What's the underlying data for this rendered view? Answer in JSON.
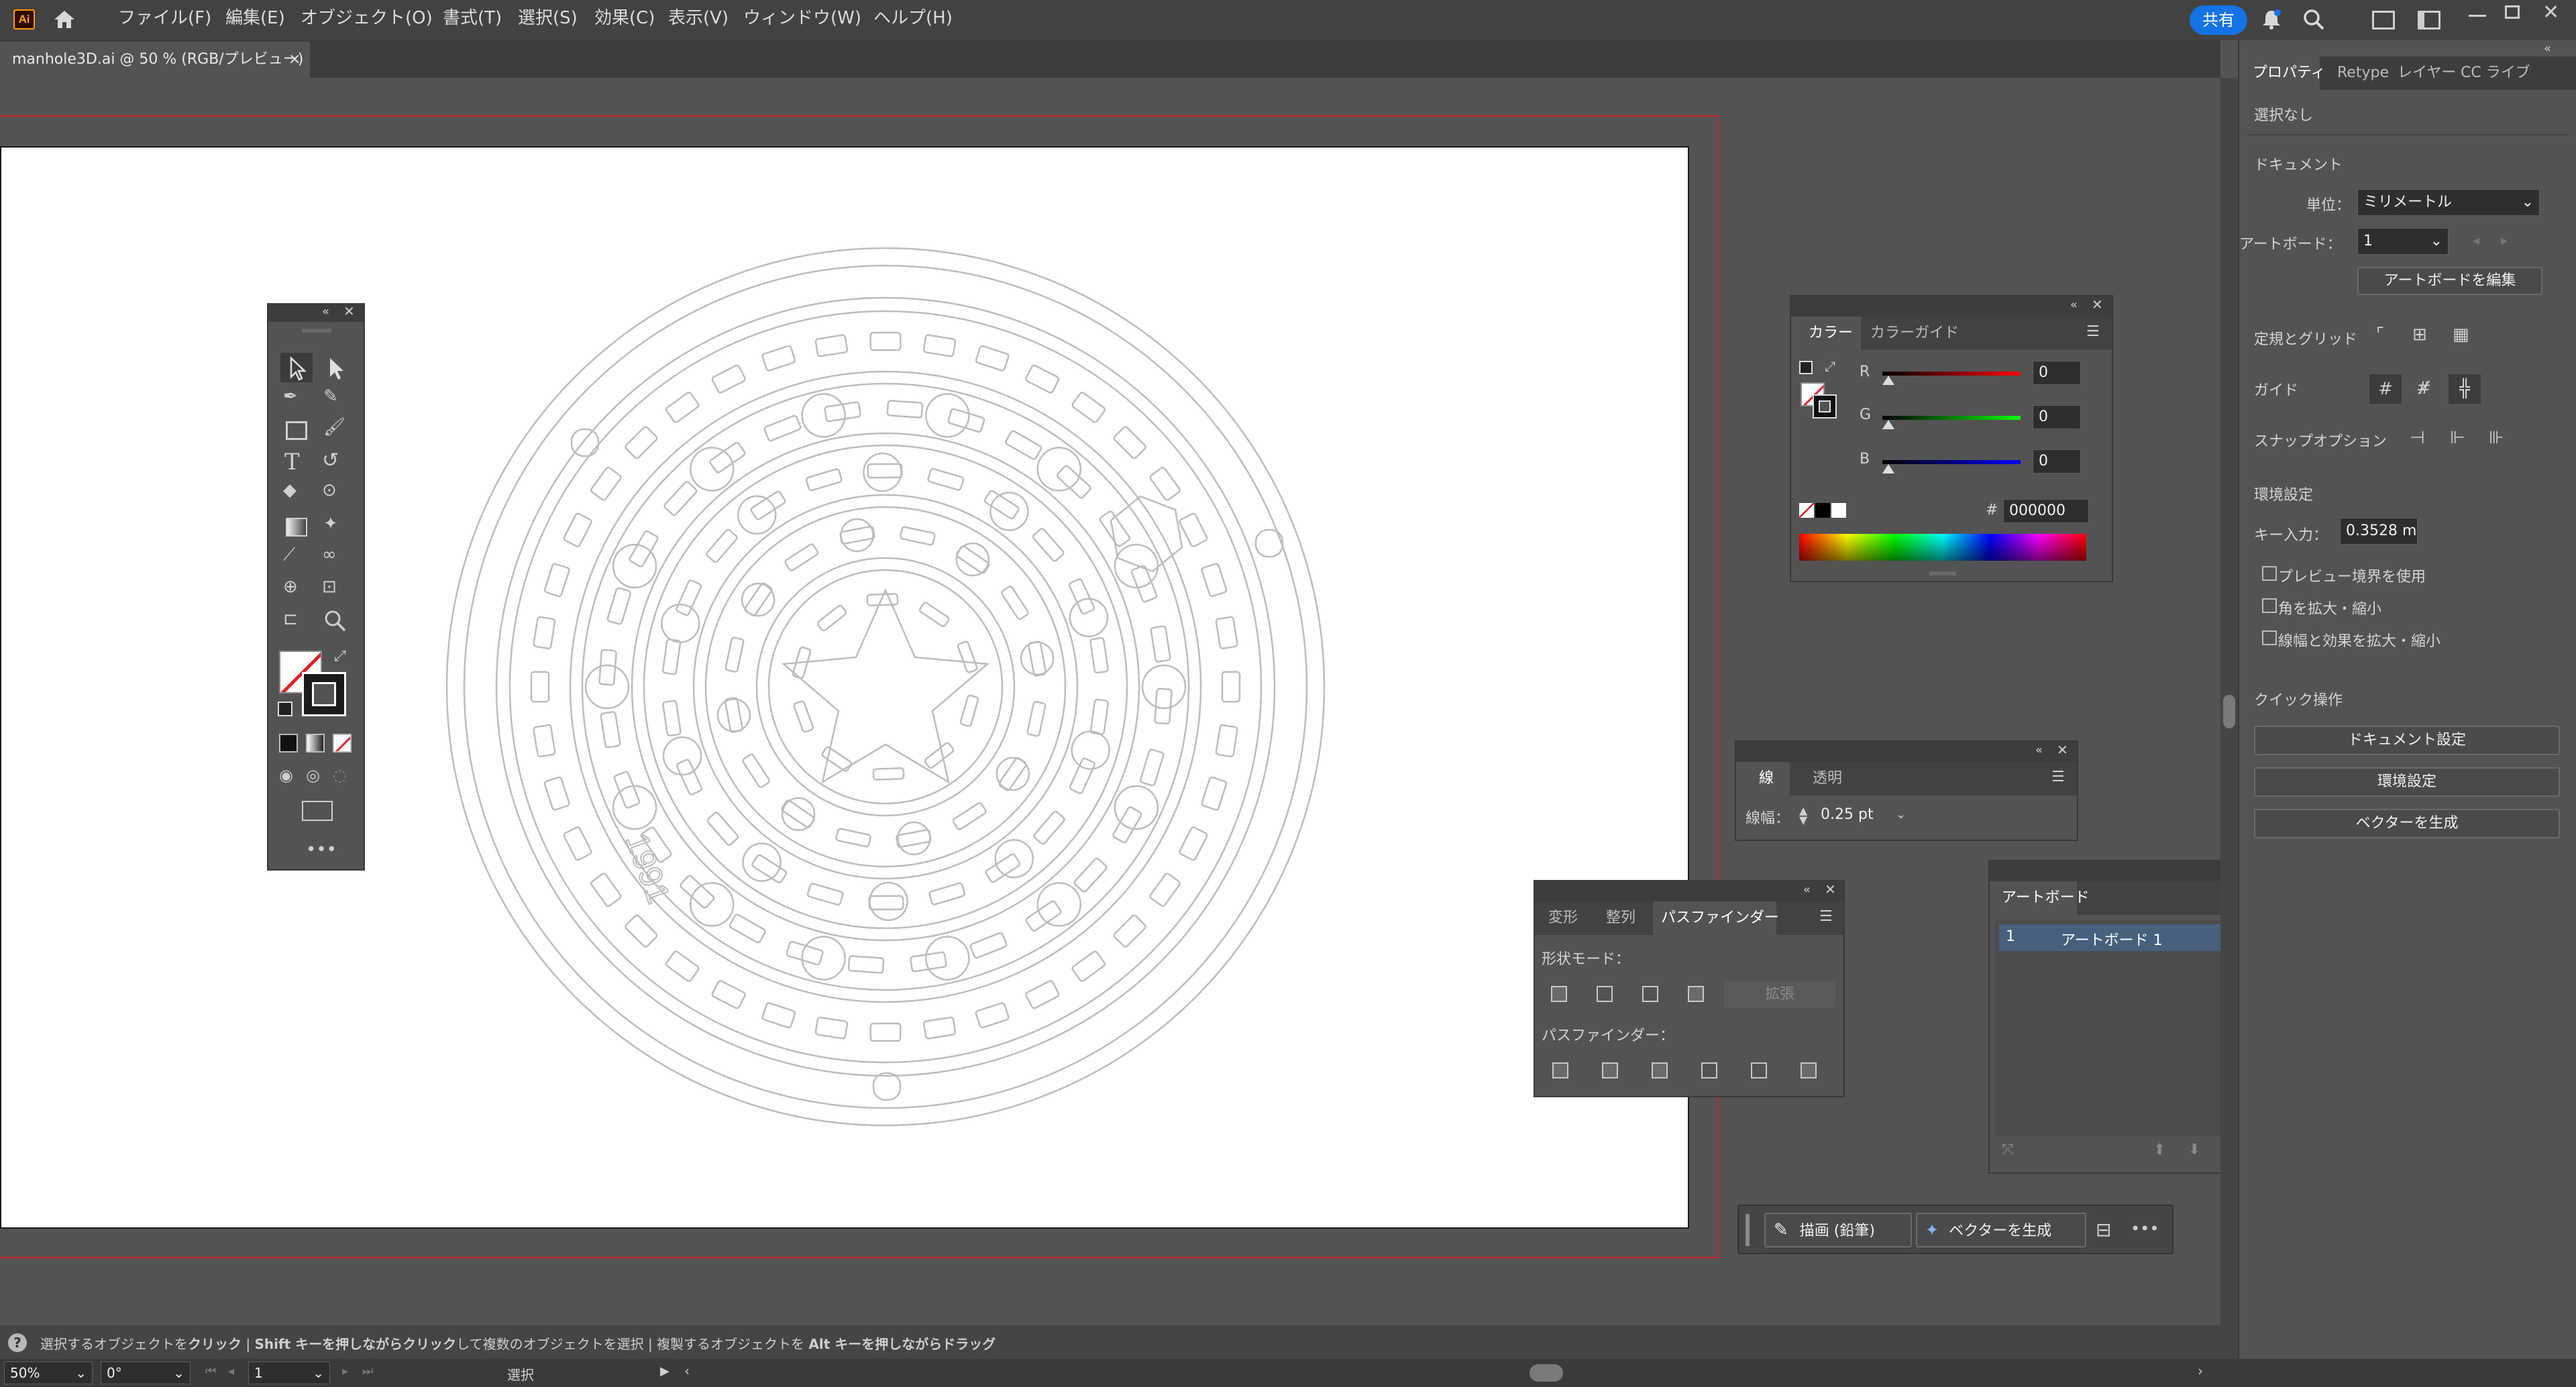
{
  "app": {
    "logo": "Ai",
    "menus": [
      "ファイル(F)",
      "編集(E)",
      "オブジェクト(O)",
      "書式(T)",
      "選択(S)",
      "効果(C)",
      "表示(V)",
      "ウィンドウ(W)",
      "ヘルプ(H)"
    ],
    "share_label": "共有",
    "icons": [
      "home-icon",
      "bell-icon",
      "search-icon",
      "arrange-icon",
      "workspace-icon",
      "minimize-icon",
      "maximize-icon",
      "close-icon"
    ]
  },
  "document": {
    "tab_title": "manhole3D.ai @ 50 % (RGB/プレビュー)",
    "tab_close": "×"
  },
  "color_panel": {
    "tabs": [
      "カラー",
      "カラーガイド"
    ],
    "channels": [
      {
        "label": "R",
        "value": "0"
      },
      {
        "label": "G",
        "value": "0"
      },
      {
        "label": "B",
        "value": "0"
      }
    ],
    "hex_label": "#",
    "hex_value": "000000"
  },
  "stroke_panel": {
    "tabs": [
      "線",
      "透明"
    ],
    "weight_label": "線幅：",
    "weight_value": "0.25 pt"
  },
  "pathfinder_panel": {
    "tabs": [
      "変形",
      "整列",
      "パスファインダー"
    ],
    "shape_modes_label": "形状モード：",
    "expand_label": "拡張",
    "pathfinders_label": "パスファインダー："
  },
  "artboards_panel": {
    "title": "アートボード",
    "rows": [
      {
        "num": "1",
        "name": "アートボード 1"
      }
    ]
  },
  "context_bar": {
    "draw_label": "描画 (鉛筆)",
    "vector_label": "ベクターを生成",
    "more": "•••"
  },
  "properties": {
    "tabs": [
      "プロパティ",
      "Retype",
      "レイヤー",
      "CC ライブ"
    ],
    "no_selection": "選択なし",
    "document_heading": "ドキュメント",
    "unit_label": "単位：",
    "unit_value": "ミリメートル",
    "artboard_label": "アートボード：",
    "artboard_value": "1",
    "edit_artboard_btn": "アートボードを編集",
    "rulers_grid_label": "定規とグリッド",
    "guides_label": "ガイド",
    "snap_label": "スナップオプション",
    "prefs_heading": "環境設定",
    "key_input_label": "キー入力：",
    "key_input_value": "0.3528 m",
    "checkboxes": [
      "プレビュー境界を使用",
      "角を拡大・縮小",
      "線幅と効果を拡大・縮小"
    ],
    "quick_actions_heading": "クイック操作",
    "quick_buttons": [
      "ドキュメント設定",
      "環境設定",
      "ベクターを生成"
    ]
  },
  "status": {
    "hint_parts": [
      "選択するオブジェクトを",
      "クリック",
      " | ",
      "Shift キーを押しながらクリック",
      "して複数のオブジェクトを選択 | 複製するオブジェクトを ",
      "Alt キーを押しながらドラッグ"
    ],
    "zoom": "50%",
    "rotation": "0°",
    "artboard_num": "1",
    "tool_name": "選択"
  },
  "artwork": {
    "plate_text": "1991"
  }
}
